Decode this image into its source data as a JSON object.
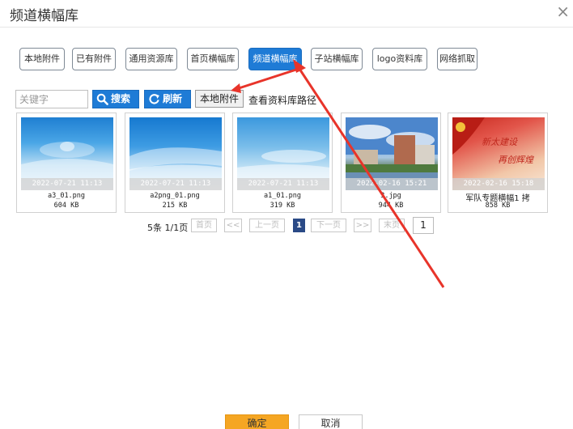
{
  "dialog": {
    "title": "频道横幅库",
    "close_symbol": "×"
  },
  "tabs": [
    {
      "label": "本地附件",
      "active": false
    },
    {
      "label": "已有附件",
      "active": false
    },
    {
      "label": "通用资源库",
      "active": false
    },
    {
      "label": "首页横幅库",
      "active": false
    },
    {
      "label": "频道横幅库",
      "active": true
    },
    {
      "label": "子站横幅库",
      "active": false
    },
    {
      "label": "logo资料库",
      "active": false
    },
    {
      "label": "网络抓取",
      "active": false
    }
  ],
  "toolbar": {
    "keyword_placeholder": "关键字",
    "search_label": "搜索",
    "refresh_label": "刷新",
    "local_attach_label": "本地附件",
    "view_path_label": "查看资料库路径"
  },
  "files": [
    {
      "date": "2022-07-21 11:13",
      "name": "a3_01.png",
      "size": "604 KB"
    },
    {
      "date": "2022-07-21 11:13",
      "name": "a2png_01.png",
      "size": "215 KB"
    },
    {
      "date": "2022-07-21 11:13",
      "name": "a1_01.png",
      "size": "319 KB"
    },
    {
      "date": "2022-02-16 15:21",
      "name": "3.jpg",
      "size": "944 KB"
    },
    {
      "date": "2022-02-16 15:18",
      "name": "军队专题横幅1 拷",
      "size": "858 KB"
    }
  ],
  "thumb_text": {
    "line1": "新太建设",
    "line2": "再创辉煌"
  },
  "pagination": {
    "info": "5条 1/1页",
    "first": "首页",
    "prev_jump": "<<",
    "prev": "上一页",
    "current": "1",
    "next": "下一页",
    "next_jump": ">>",
    "last": "末页",
    "page_input": "1"
  },
  "footer": {
    "ok_label": "确定",
    "cancel_label": "取消"
  },
  "colors": {
    "accent_blue": "#1e7bd6",
    "confirm_orange": "#f5a623",
    "annotation_red": "#e8342a",
    "pager_current": "#2a4a86"
  }
}
